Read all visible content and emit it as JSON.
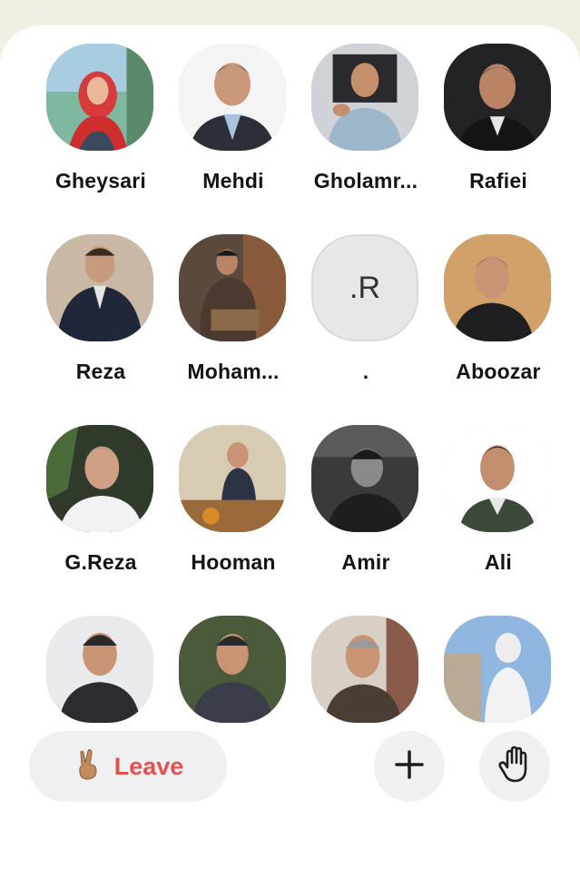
{
  "participants": [
    {
      "name": "Gheysari"
    },
    {
      "name": "Mehdi"
    },
    {
      "name": "Gholamr..."
    },
    {
      "name": "Rafiei"
    },
    {
      "name": "Reza"
    },
    {
      "name": "Moham..."
    },
    {
      "name": ".",
      "initials": ".R"
    },
    {
      "name": "Aboozar"
    },
    {
      "name": "G.Reza"
    },
    {
      "name": "Hooman"
    },
    {
      "name": "Amir"
    },
    {
      "name": "Ali"
    }
  ],
  "controls": {
    "leave_label": "Leave",
    "leave_icon": "victory-hand-emoji",
    "add_icon": "plus-icon",
    "raise_hand_icon": "raised-hand-icon"
  },
  "colors": {
    "leave_text": "#e0524e",
    "button_bg": "#f0f0f2",
    "page_bg": "#f1eee4"
  }
}
